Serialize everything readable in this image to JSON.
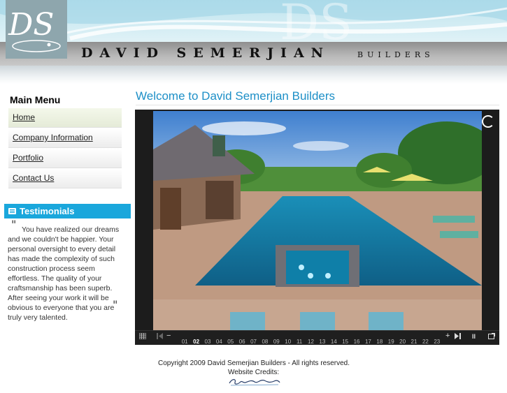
{
  "header": {
    "brand_name": "DAVID SEMERJIAN",
    "brand_sub": "BUILDERS",
    "logo_text": "DS"
  },
  "sidebar": {
    "main_menu_title": "Main Menu",
    "menu_items": [
      {
        "label": "Home"
      },
      {
        "label": "Company Information"
      },
      {
        "label": "Portfolio"
      },
      {
        "label": "Contact Us"
      }
    ],
    "testimonials_title": "Testimonials",
    "quote_open": "\"",
    "quote_close": "\"",
    "testimonial_text": "You have realized our dreams and we couldn't be happier. Your personal oversight to every detail has made the complexity of such construction process seem effortless. The quality of your craftsmanship has been superb. After seeing your work it will be obvious to everyone that you are truly very talented."
  },
  "main": {
    "welcome_title": "Welcome to David Semerjian Builders"
  },
  "slideshow": {
    "current_slide": "02",
    "slide_numbers": [
      "01",
      "02",
      "03",
      "04",
      "05",
      "06",
      "07",
      "08",
      "09",
      "10",
      "11",
      "12",
      "13",
      "14",
      "15",
      "16",
      "17",
      "18",
      "19",
      "20",
      "21",
      "22",
      "23"
    ],
    "icons": [
      "thumbnails-icon",
      "previous-icon",
      "minus-icon",
      "plus-icon",
      "next-icon",
      "pause-icon",
      "fullscreen-icon"
    ],
    "plus_label": "+",
    "minus_label": "−",
    "pause_label": "II"
  },
  "footer": {
    "copyright": "Copyright 2009 David Semerjian Builders - All rights reserved.",
    "credits_label": "Website Credits:"
  },
  "colors": {
    "accent_blue": "#1aa7dc",
    "title_blue": "#1d8fc7",
    "slideshow_bg": "#1c1c1c"
  }
}
